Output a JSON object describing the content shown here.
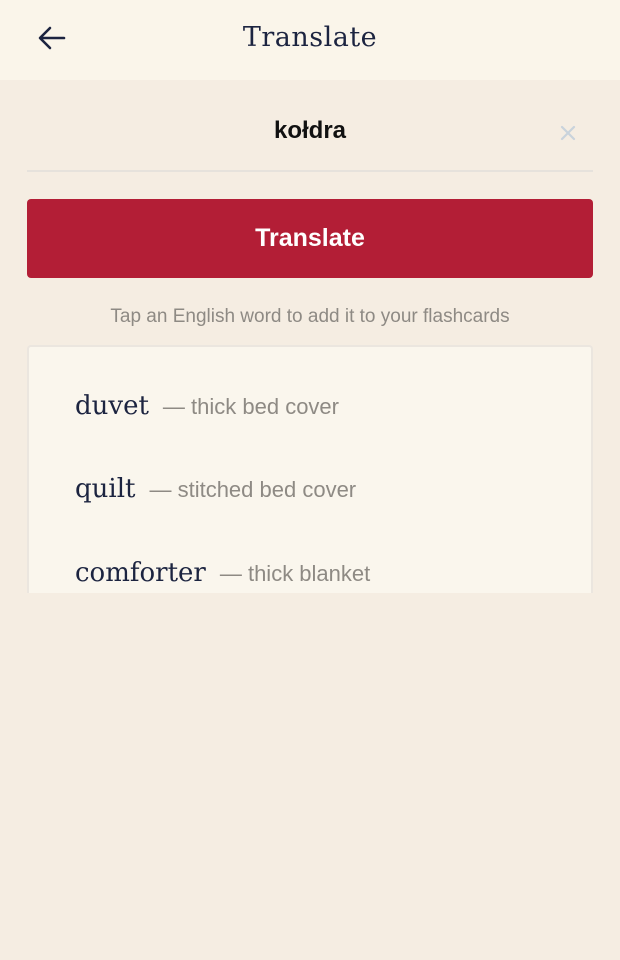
{
  "header": {
    "back_icon": "arrow-left-icon",
    "title": "Translate"
  },
  "input": {
    "value": "kołdra",
    "clear_icon": "close-icon"
  },
  "translate_button": {
    "label": "Translate"
  },
  "hint": "Tap an English word to add it to your flashcards",
  "results": [
    {
      "word": "duvet",
      "definition": "— thick bed cover"
    },
    {
      "word": "quilt",
      "definition": "— stitched bed cover"
    },
    {
      "word": "comforter",
      "definition": "— thick blanket"
    }
  ],
  "colors": {
    "background": "#f5ede2",
    "header_background": "#faf5ea",
    "accent": "#b31e36",
    "title_text": "#1c2440",
    "muted_text": "#8e8a84"
  }
}
